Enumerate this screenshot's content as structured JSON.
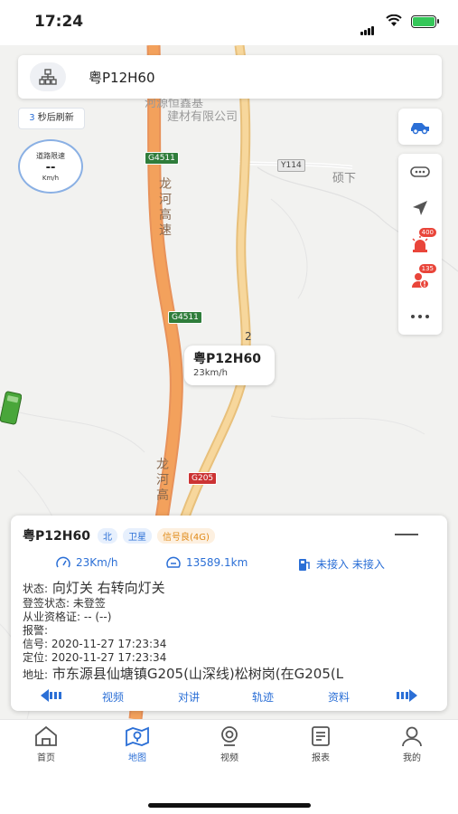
{
  "status_bar": {
    "time": "17:24"
  },
  "header": {
    "plate": "粤P12H60"
  },
  "refresh": {
    "count": "3",
    "label": "秒后刷新"
  },
  "speed_limit": {
    "title": "道路限速",
    "value": "--",
    "unit": "Km/h"
  },
  "map_labels": {
    "poi": "河源恒鑫基\n建材有限公司",
    "poi_line1": "河源恒鑫基",
    "poi_line2": "建材有限公司",
    "y114": "Y114",
    "place": "硕下",
    "g4511_a": "G4511",
    "g4511_b": "G4511",
    "g205": "G205",
    "road_num": "2",
    "expressway_1": "龙河高速",
    "expressway_2": "龙河高"
  },
  "right_tools": {
    "alarm_badge": "400",
    "driver_badge": "135"
  },
  "callout": {
    "plate": "粤P12H60",
    "speed": "23km/h"
  },
  "panel": {
    "plate": "粤P12H60",
    "tags": {
      "direction": "北",
      "sat": "卫星",
      "signal": "信号良(4G)"
    },
    "speed": "23Km/h",
    "mileage": "13589.1km",
    "fuel": "未接入 未接入",
    "status_label": "状态:",
    "status_value": "向灯关 右转向灯关",
    "sign_label": "登签状态:",
    "sign_value": "未登签",
    "cert_label": "从业资格证:",
    "cert_value": "-- (--)",
    "alarm_label": "报警:",
    "alarm_value": "",
    "signal_label": "信号:",
    "signal_value": "2020-11-27 17:23:34",
    "locate_label": "定位:",
    "locate_value": "2020-11-27 17:23:34",
    "addr_label": "地址:",
    "addr_value": "市东源县仙塘镇G205(山深线)松树岗(在G205(L",
    "actions": {
      "video": "视频",
      "talk": "对讲",
      "track": "轨迹",
      "info": "资料"
    }
  },
  "tabs": [
    {
      "label": "首页"
    },
    {
      "label": "地图"
    },
    {
      "label": "视频"
    },
    {
      "label": "报表"
    },
    {
      "label": "我的"
    }
  ],
  "colors": {
    "accent": "#2b6fd6",
    "road_main": "#f3a15c",
    "road_secondary": "#f2c77a",
    "badge": "#e9453a"
  }
}
